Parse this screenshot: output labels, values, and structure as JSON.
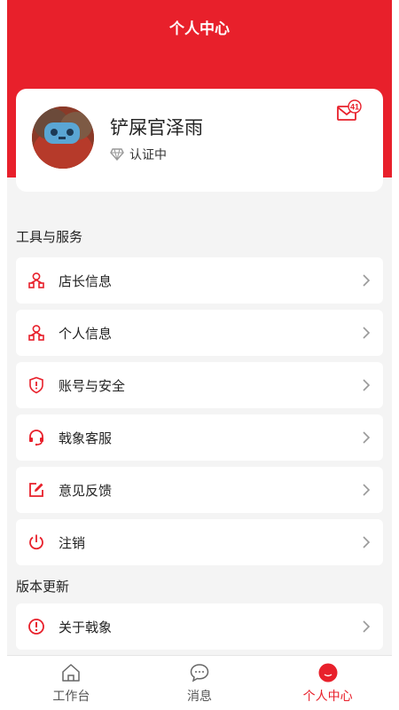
{
  "header": {
    "title": "个人中心"
  },
  "profile": {
    "name": "铲屎官泽雨",
    "verify_status": "认证中",
    "mail_badge": "41"
  },
  "sections": {
    "tools": "工具与服务",
    "version": "版本更新"
  },
  "menu": {
    "shop_owner": "店长信息",
    "personal": "个人信息",
    "account_security": "账号与安全",
    "customer_service": "戟象客服",
    "feedback": "意见反馈",
    "logout": "注销",
    "about": "关于戟象"
  },
  "tabs": {
    "workbench": "工作台",
    "messages": "消息",
    "profile": "个人中心"
  },
  "colors": {
    "accent": "#e8202b",
    "background": "#f4f4f4"
  }
}
